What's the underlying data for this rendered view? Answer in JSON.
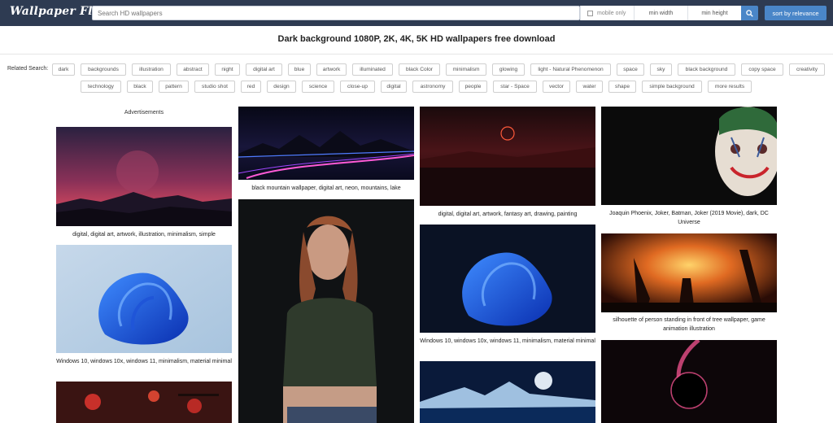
{
  "header": {
    "logo": "Wallpaper Flare",
    "search_placeholder": "Search HD wallpapers",
    "mobile_only": "mobile only",
    "min_width": "min width",
    "min_height": "min height",
    "sort_label": "sort by relevance"
  },
  "page_title": "Dark background 1080P, 2K, 4K, 5K HD wallpapers free download",
  "related": {
    "label": "Related Search:",
    "row1": [
      "dark",
      "backgrounds",
      "illustration",
      "abstract",
      "night",
      "digital art",
      "blue",
      "artwork",
      "illuminated",
      "black Color",
      "minimalism",
      "glowing",
      "light - Natural Phenomenon",
      "space",
      "sky",
      "black background",
      "copy space",
      "creativity"
    ],
    "row2": [
      "technology",
      "black",
      "pattern",
      "studio shot",
      "red",
      "design",
      "science",
      "close-up",
      "digital",
      "astronomy",
      "people",
      "star - Space",
      "vector",
      "water",
      "shape",
      "simple background",
      "more results"
    ]
  },
  "ads_label": "Advertisements",
  "captions": {
    "c1a": "digital, digital art, artwork, illustration, minimalism, simple",
    "c1b": "Windows 10, windows 10x, windows 11, minimalism, material minimal",
    "c2a": "black mountain wallpaper, digital art, neon, mountains, lake",
    "c3a": "digital, digital art, artwork, fantasy art, drawing, painting",
    "c3b": "Windows 10, windows 10x, windows 11, minimalism, material minimal",
    "c4a": "Joaquin Phoenix, Joker, Batman, Joker (2019 Movie), dark, DC Universe",
    "c4b": "silhouette of person standing in front of tree wallpaper, game animation illustration"
  }
}
